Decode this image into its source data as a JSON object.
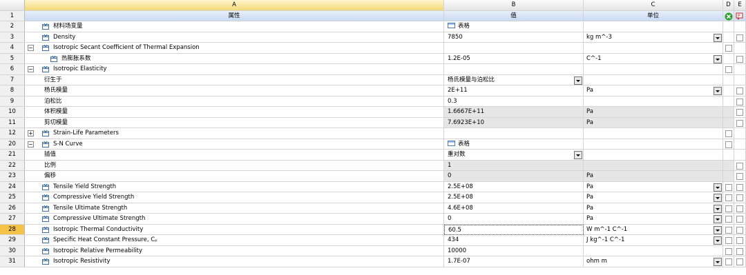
{
  "columns": {
    "row_header": "",
    "a": "A",
    "b": "B",
    "c": "C",
    "d": "D",
    "e": "E"
  },
  "header_row": {
    "num": "1",
    "a": "属性",
    "b": "值",
    "c": "单位"
  },
  "rows": [
    {
      "num": "2",
      "label": "材料场变量",
      "value": "表格",
      "unit": ""
    },
    {
      "num": "3",
      "label": "Density",
      "value": "7850",
      "unit": "kg m^-3"
    },
    {
      "num": "4",
      "label": "Isotropic Secant Coefficient of Thermal Expansion",
      "value": "",
      "unit": ""
    },
    {
      "num": "5",
      "label": "热膨胀系数",
      "value": "1.2E-05",
      "unit": "C^-1"
    },
    {
      "num": "6",
      "label": "Isotropic Elasticity",
      "value": "",
      "unit": ""
    },
    {
      "num": "7",
      "label": "衍生于",
      "value": "杨氏模量与泊松比",
      "unit": ""
    },
    {
      "num": "8",
      "label": "杨氏模量",
      "value": "2E+11",
      "unit": "Pa"
    },
    {
      "num": "9",
      "label": "泊松比",
      "value": "0.3",
      "unit": ""
    },
    {
      "num": "10",
      "label": "体积模量",
      "value": "1.6667E+11",
      "unit": "Pa"
    },
    {
      "num": "11",
      "label": "剪切模量",
      "value": "7.6923E+10",
      "unit": "Pa"
    },
    {
      "num": "12",
      "label": "Strain-Life Parameters",
      "value": "",
      "unit": ""
    },
    {
      "num": "20",
      "label": "S-N Curve",
      "value": "表格",
      "unit": ""
    },
    {
      "num": "21",
      "label": "插值",
      "value": "重对数",
      "unit": ""
    },
    {
      "num": "22",
      "label": "比例",
      "value": "1",
      "unit": ""
    },
    {
      "num": "23",
      "label": "偏移",
      "value": "0",
      "unit": "Pa"
    },
    {
      "num": "24",
      "label": "Tensile Yield Strength",
      "value": "2.5E+08",
      "unit": "Pa"
    },
    {
      "num": "25",
      "label": "Compressive Yield Strength",
      "value": "2.5E+08",
      "unit": "Pa"
    },
    {
      "num": "26",
      "label": "Tensile Ultimate Strength",
      "value": "4.6E+08",
      "unit": "Pa"
    },
    {
      "num": "27",
      "label": "Compressive Ultimate Strength",
      "value": "0",
      "unit": "Pa"
    },
    {
      "num": "28",
      "label": "Isotropic Thermal Conductivity",
      "value": "60.5",
      "unit": "W m^-1 C^-1"
    },
    {
      "num": "29",
      "label": "Specific Heat Constant Pressure, Cₚ",
      "value": "434",
      "unit": "J kg^-1 C^-1"
    },
    {
      "num": "30",
      "label": "Isotropic Relative Permeability",
      "value": "10000",
      "unit": ""
    },
    {
      "num": "31",
      "label": "Isotropic Resistivity",
      "value": "1.7E-07",
      "unit": "ohm m"
    }
  ],
  "colors": {
    "selected_row": "#f6c34a",
    "header_a": "#f3d97a",
    "row1": "#c9daf2",
    "gray_cell": "#e6e6e6"
  }
}
